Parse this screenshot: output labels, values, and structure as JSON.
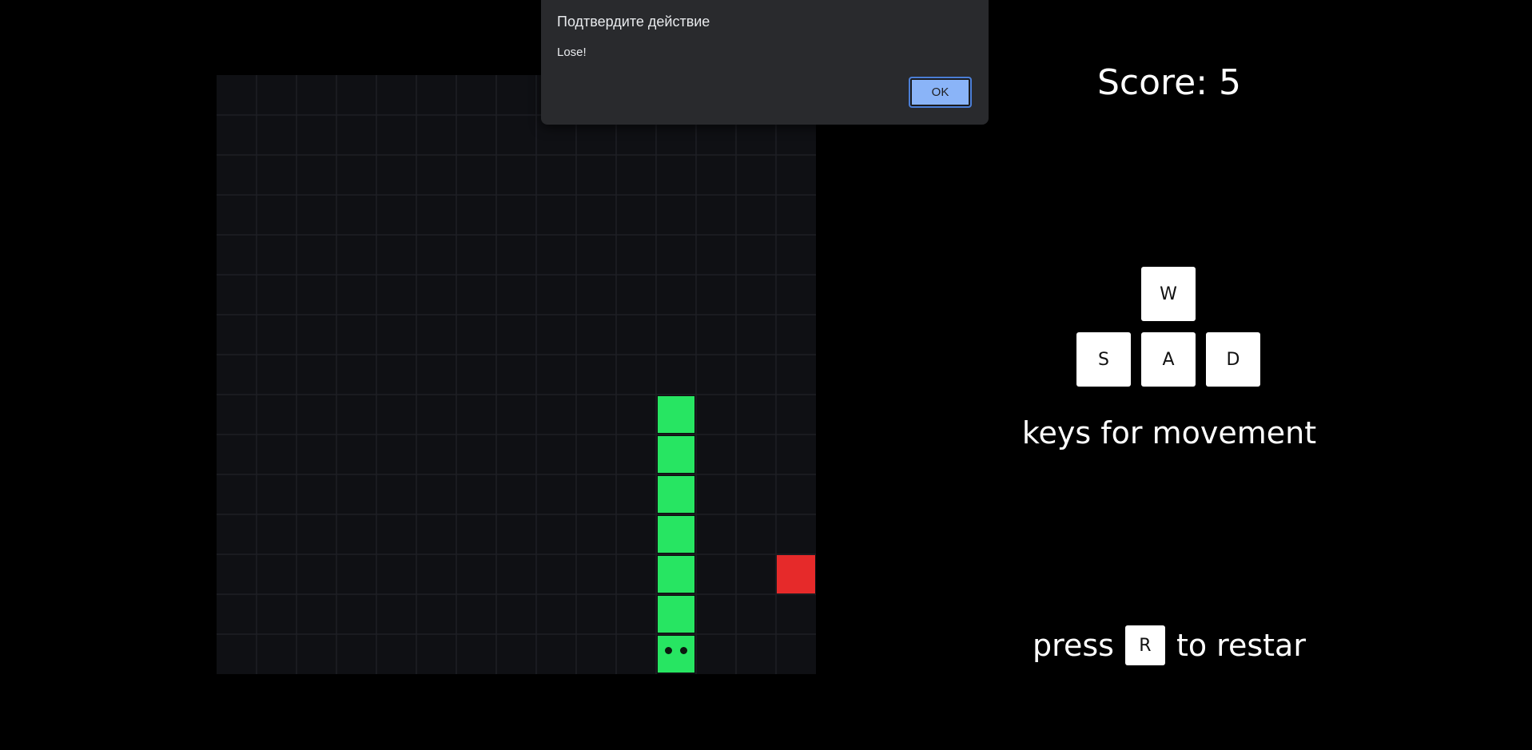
{
  "dialog": {
    "title": "Подтвердите действие",
    "message": "Lose!",
    "ok_label": "OK"
  },
  "game": {
    "score_text": "Score: 5",
    "grid_size": 15,
    "snake": [
      {
        "col": 11,
        "row": 8
      },
      {
        "col": 11,
        "row": 9
      },
      {
        "col": 11,
        "row": 10
      },
      {
        "col": 11,
        "row": 11
      },
      {
        "col": 11,
        "row": 12
      },
      {
        "col": 11,
        "row": 13
      },
      {
        "col": 11,
        "row": 14
      }
    ],
    "snake_head_index": 6,
    "food": {
      "col": 14,
      "row": 12
    },
    "colors": {
      "board": "#0f1014",
      "grid_line": "#1e1f25",
      "snake": "#27e562",
      "food": "#e62a2a"
    }
  },
  "controls": {
    "keys": {
      "up": "W",
      "left": "S",
      "middle": "A",
      "right": "D"
    },
    "movement_label": "keys for movement",
    "restart_prefix": "press",
    "restart_key": "R",
    "restart_suffix": "to restar"
  }
}
